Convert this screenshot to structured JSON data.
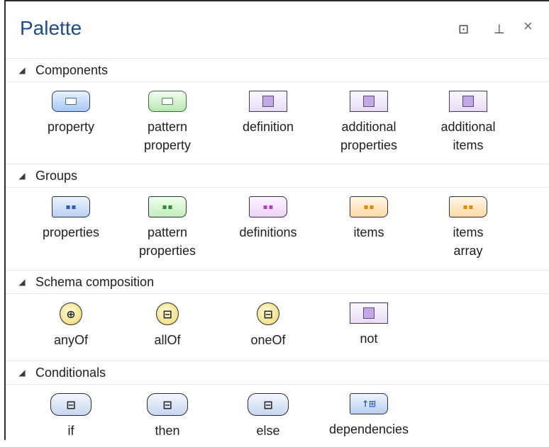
{
  "panel": {
    "title": "Palette",
    "float_glyph": "⊡",
    "pin_glyph": "⊥",
    "close_glyph": "×"
  },
  "sections": [
    {
      "title": "Components",
      "items": [
        {
          "label": "property",
          "icon": "blue-input-pill-icon"
        },
        {
          "label": "pattern\nproperty",
          "icon": "green-input-pill-icon"
        },
        {
          "label": "definition",
          "icon": "purple-square-icon"
        },
        {
          "label": "additional\nproperties",
          "icon": "purple-square-icon"
        },
        {
          "label": "additional\nitems",
          "icon": "purple-square-icon"
        }
      ]
    },
    {
      "title": "Groups",
      "items": [
        {
          "label": "properties",
          "icon": "blue-group-icon",
          "glyph": "▪▪"
        },
        {
          "label": "pattern\nproperties",
          "icon": "green-group-icon",
          "glyph": "▪▪"
        },
        {
          "label": "definitions",
          "icon": "purple-group-icon",
          "glyph": "▪▪"
        },
        {
          "label": "items",
          "icon": "orange-group-icon",
          "glyph": "▪▪"
        },
        {
          "label": "items\narray",
          "icon": "orange-group-icon",
          "glyph": "▪▪"
        }
      ]
    },
    {
      "title": "Schema composition",
      "items": [
        {
          "label": "anyOf",
          "icon": "anyof-circle-icon",
          "glyph": "⊕"
        },
        {
          "label": "allOf",
          "icon": "allof-circle-icon",
          "glyph": "⊟"
        },
        {
          "label": "oneOf",
          "icon": "oneof-circle-icon",
          "glyph": "⊟"
        },
        {
          "label": "not",
          "icon": "purple-square-icon"
        }
      ]
    },
    {
      "title": "Conditionals",
      "items": [
        {
          "label": "if",
          "icon": "if-octagon-icon",
          "glyph": "⊟"
        },
        {
          "label": "then",
          "icon": "then-octagon-icon",
          "glyph": "⊟"
        },
        {
          "label": "else",
          "icon": "else-octagon-icon",
          "glyph": "⊟"
        },
        {
          "label": "dependencies",
          "icon": "dependencies-icon",
          "glyph": "↑⊞"
        }
      ]
    }
  ],
  "colors": {
    "title": "#1f4a86",
    "border": "#2b2b2b",
    "blue_fill": "#a9c7f2",
    "green_fill": "#b9e6b3",
    "purple_fill": "#c2a8e4",
    "orange_fill": "#fbd9a3",
    "yellow_fill": "#e9d76a"
  }
}
